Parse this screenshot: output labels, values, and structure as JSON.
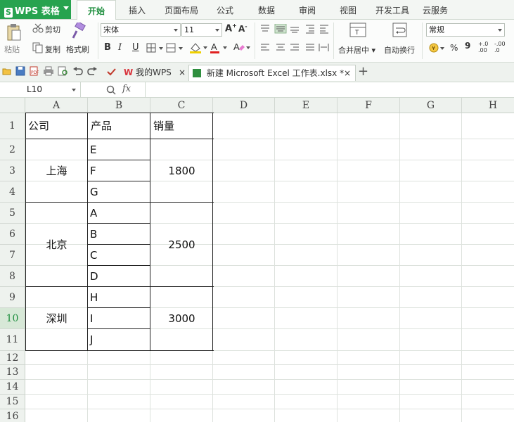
{
  "app": {
    "name": "WPS 表格"
  },
  "menu": {
    "tabs": [
      "开始",
      "插入",
      "页面布局",
      "公式",
      "数据",
      "审阅",
      "视图",
      "开发工具",
      "云服务"
    ],
    "active": "开始"
  },
  "ribbon": {
    "paste": "粘贴",
    "cut": "剪切",
    "copy": "复制",
    "format_painter": "格式刷",
    "font_name": "宋体",
    "font_size": "11",
    "bold": "B",
    "italic": "I",
    "underline": "U",
    "font_color_letter": "A",
    "merge_center": "合并居中",
    "wrap_text": "自动换行",
    "number_format": "常规",
    "percent": "%",
    "thousands": "9",
    "inc_decimal": "+.0\n.00",
    "dec_decimal": "-.00\n.0"
  },
  "quick": {
    "doc_tabs": [
      {
        "label": "我的WPS",
        "close": "×"
      },
      {
        "label": "新建 Microsoft Excel 工作表.xlsx *",
        "close": "×"
      }
    ],
    "new_tab": "+"
  },
  "formula_bar": {
    "cell_ref": "L10",
    "fx": "fx",
    "content": ""
  },
  "sheet": {
    "columns": [
      "A",
      "B",
      "C",
      "D",
      "E",
      "F",
      "G",
      "H"
    ],
    "rows": [
      "1",
      "2",
      "3",
      "4",
      "5",
      "6",
      "7",
      "8",
      "9",
      "10",
      "11",
      "12",
      "13",
      "14",
      "15",
      "16"
    ],
    "selected_row": "10",
    "headers": {
      "A": "公司",
      "B": "产品",
      "C": "销量"
    },
    "groups": [
      {
        "company": "上海",
        "products": [
          "E",
          "F",
          "G"
        ],
        "sales": "1800"
      },
      {
        "company": "北京",
        "products": [
          "A",
          "B",
          "C",
          "D"
        ],
        "sales": "2500"
      },
      {
        "company": "深圳",
        "products": [
          "H",
          "I",
          "J"
        ],
        "sales": "3000"
      }
    ]
  },
  "colors": {
    "brand_green": "#27a34f",
    "active_tab_text": "#1f8f3f",
    "wps_logo_red": "#d9363e"
  }
}
